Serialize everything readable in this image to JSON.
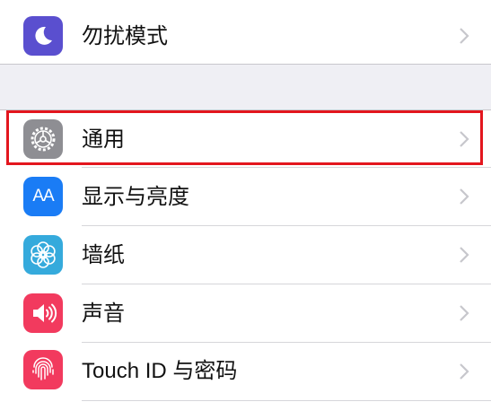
{
  "settings": {
    "items": [
      {
        "label": "勿扰模式",
        "icon": "moon-icon",
        "icon_color": "#5a4fcf"
      },
      {
        "label": "通用",
        "icon": "gear-icon",
        "icon_color": "#8e8e93"
      },
      {
        "label": "显示与亮度",
        "icon": "text-size-icon",
        "icon_text": "AA",
        "icon_color": "#1a7cf5"
      },
      {
        "label": "墙纸",
        "icon": "flower-icon",
        "icon_color": "#35aadc"
      },
      {
        "label": "声音",
        "icon": "speaker-icon",
        "icon_color": "#f23a5e"
      },
      {
        "label": "Touch ID 与密码",
        "icon": "fingerprint-icon",
        "icon_color": "#f23a5e"
      }
    ]
  },
  "highlight_color": "#e3161e"
}
